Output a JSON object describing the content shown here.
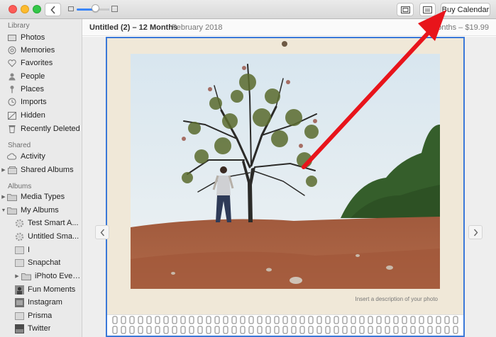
{
  "toolbar": {
    "back_icon": "chevron-left-icon",
    "buy_label": "Buy Calendar"
  },
  "sidebar": {
    "library_header": "Library",
    "library": [
      {
        "label": "Photos",
        "icon": "photos-icon"
      },
      {
        "label": "Memories",
        "icon": "memories-icon"
      },
      {
        "label": "Favorites",
        "icon": "heart-icon"
      },
      {
        "label": "People",
        "icon": "person-icon"
      },
      {
        "label": "Places",
        "icon": "pin-icon"
      },
      {
        "label": "Imports",
        "icon": "clock-icon"
      },
      {
        "label": "Hidden",
        "icon": "hidden-icon"
      },
      {
        "label": "Recently Deleted",
        "icon": "trash-icon"
      }
    ],
    "shared_header": "Shared",
    "shared": [
      {
        "label": "Activity",
        "icon": "cloud-icon"
      },
      {
        "label": "Shared Albums",
        "icon": "shared-album-icon"
      }
    ],
    "albums_header": "Albums",
    "albums": [
      {
        "label": "Media Types",
        "icon": "folder-icon"
      },
      {
        "label": "My Albums",
        "icon": "folder-icon"
      },
      {
        "label": "Test Smart A...",
        "icon": "gear-icon"
      },
      {
        "label": "Untitled Sma...",
        "icon": "gear-icon"
      },
      {
        "label": "I",
        "icon": "album-icon"
      },
      {
        "label": "Snapchat",
        "icon": "album-icon"
      },
      {
        "label": "iPhoto Events",
        "icon": "folder-icon"
      },
      {
        "label": "Fun Moments",
        "icon": "album-thumb-icon"
      },
      {
        "label": "Instagram",
        "icon": "album-thumb-icon"
      },
      {
        "label": "Prisma",
        "icon": "album-icon"
      },
      {
        "label": "Twitter",
        "icon": "album-thumb-icon"
      }
    ]
  },
  "main": {
    "title": "Untitled (2) – 12 Months",
    "month": "February 2018",
    "price": "onths – $19.99",
    "caption": "Insert a description of your photo"
  },
  "colors": {
    "accent": "#3a78d8",
    "page_bg": "#f0e8d8",
    "arrow": "#e8141b"
  }
}
